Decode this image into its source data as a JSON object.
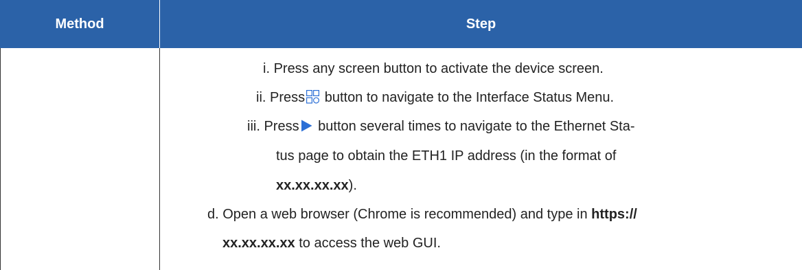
{
  "header": {
    "method_label": "Method",
    "step_label": "Step"
  },
  "steps": {
    "i_prefix": "i.",
    "i_text": "Press any screen button to activate the device screen.",
    "ii_prefix": "ii.",
    "ii_before": "Press",
    "ii_after": "button to navigate to the Interface Status Menu.",
    "ii_icon": "menu-grid-icon",
    "iii_prefix": "iii.",
    "iii_before": "Press",
    "iii_after": "button several times to navigate to the Ethernet Sta-",
    "iii_icon": "play-triangle-icon",
    "iii_line2": "tus page to obtain the ETH1 IP address (in the format of",
    "iii_line3_bold": "xx.xx.xx.xx",
    "iii_line3_rest": ").",
    "d_prefix": "d.",
    "d_text": "Open a web browser (Chrome is recommended) and type in",
    "d_bold1": "https://",
    "d_line2_bold": "xx.xx.xx.xx",
    "d_line2_rest": "to access the web GUI."
  },
  "colors": {
    "header_bg": "#2b62a8",
    "icon_blue": "#2b6fd6"
  }
}
